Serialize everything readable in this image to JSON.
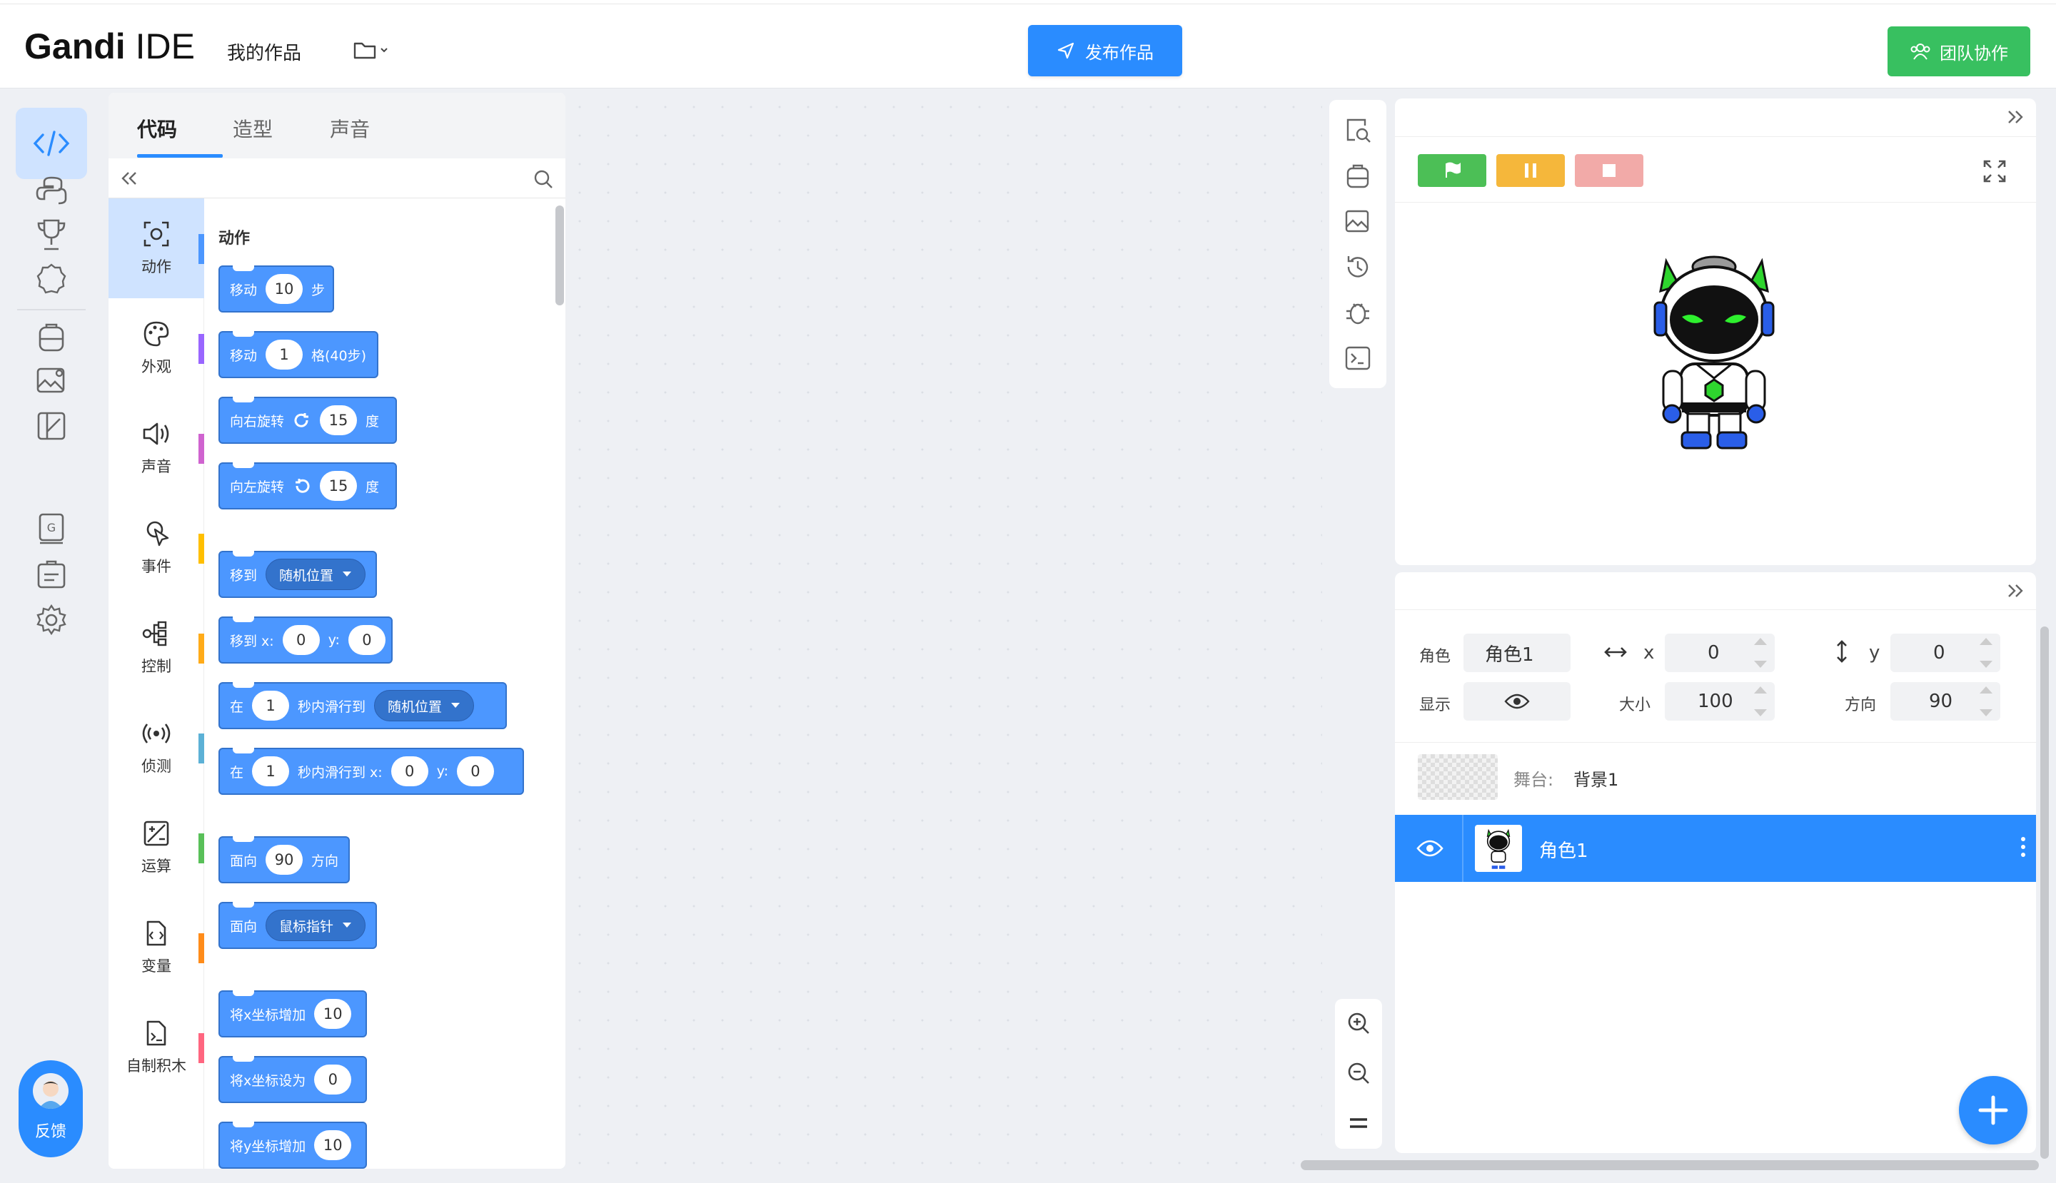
{
  "app": {
    "logo_bold": "Gandi",
    "logo_light": " IDE"
  },
  "header": {
    "my_works": "我的作品",
    "publish": "发布作品",
    "team": "团队协作"
  },
  "rail": {
    "feedback": "反馈"
  },
  "palette": {
    "tabs": [
      "代码",
      "造型",
      "声音"
    ],
    "section_title": "动作",
    "categories": [
      {
        "label": "动作",
        "color": "#4c97ff"
      },
      {
        "label": "外观",
        "color": "#9966ff"
      },
      {
        "label": "声音",
        "color": "#cf63cf"
      },
      {
        "label": "事件",
        "color": "#ffbf00"
      },
      {
        "label": "控制",
        "color": "#ffab19"
      },
      {
        "label": "侦测",
        "color": "#5cb1d6"
      },
      {
        "label": "运算",
        "color": "#59c059"
      },
      {
        "label": "变量",
        "color": "#ff8c1a"
      },
      {
        "label": "自制积木",
        "color": "#ff6680"
      }
    ],
    "blocks": {
      "move": {
        "a": "移动",
        "v": "10",
        "b": "步"
      },
      "move_grid": {
        "a": "移动",
        "v": "1",
        "b": "格(40步)"
      },
      "turn_right": {
        "a": "向右旋转",
        "v": "15",
        "b": "度"
      },
      "turn_left": {
        "a": "向左旋转",
        "v": "15",
        "b": "度"
      },
      "goto": {
        "a": "移到",
        "d": "随机位置"
      },
      "goto_xy": {
        "a": "移到 x:",
        "x": "0",
        "ylab": "y:",
        "y": "0"
      },
      "glide": {
        "a": "在",
        "v": "1",
        "b": "秒内滑行到",
        "d": "随机位置"
      },
      "glide_xy": {
        "a": "在",
        "v": "1",
        "b": "秒内滑行到 x:",
        "x": "0",
        "ylab": "y:",
        "y": "0"
      },
      "point_dir": {
        "a": "面向",
        "v": "90",
        "b": "方向"
      },
      "point_towards": {
        "a": "面向",
        "d": "鼠标指针"
      },
      "change_x": {
        "a": "将x坐标增加",
        "v": "10"
      },
      "set_x": {
        "a": "将x坐标设为",
        "v": "0"
      },
      "change_y": {
        "a": "将y坐标增加",
        "v": "10"
      }
    }
  },
  "sprite_info": {
    "sprite_label": "角色",
    "sprite_name": "角色1",
    "x_label": "x",
    "x_value": "0",
    "y_label": "y",
    "y_value": "0",
    "show_label": "显示",
    "size_label": "大小",
    "size_value": "100",
    "direction_label": "方向",
    "direction_value": "90",
    "stage_label": "舞台:",
    "stage_backdrop": "背景1",
    "list_sprite_name": "角色1"
  },
  "colors": {
    "accent": "#2a8cff",
    "team_green": "#38c060",
    "flag_green": "#4cbf56",
    "pause_yellow": "#f5b73b",
    "stop_red": "#f2aaa8"
  }
}
